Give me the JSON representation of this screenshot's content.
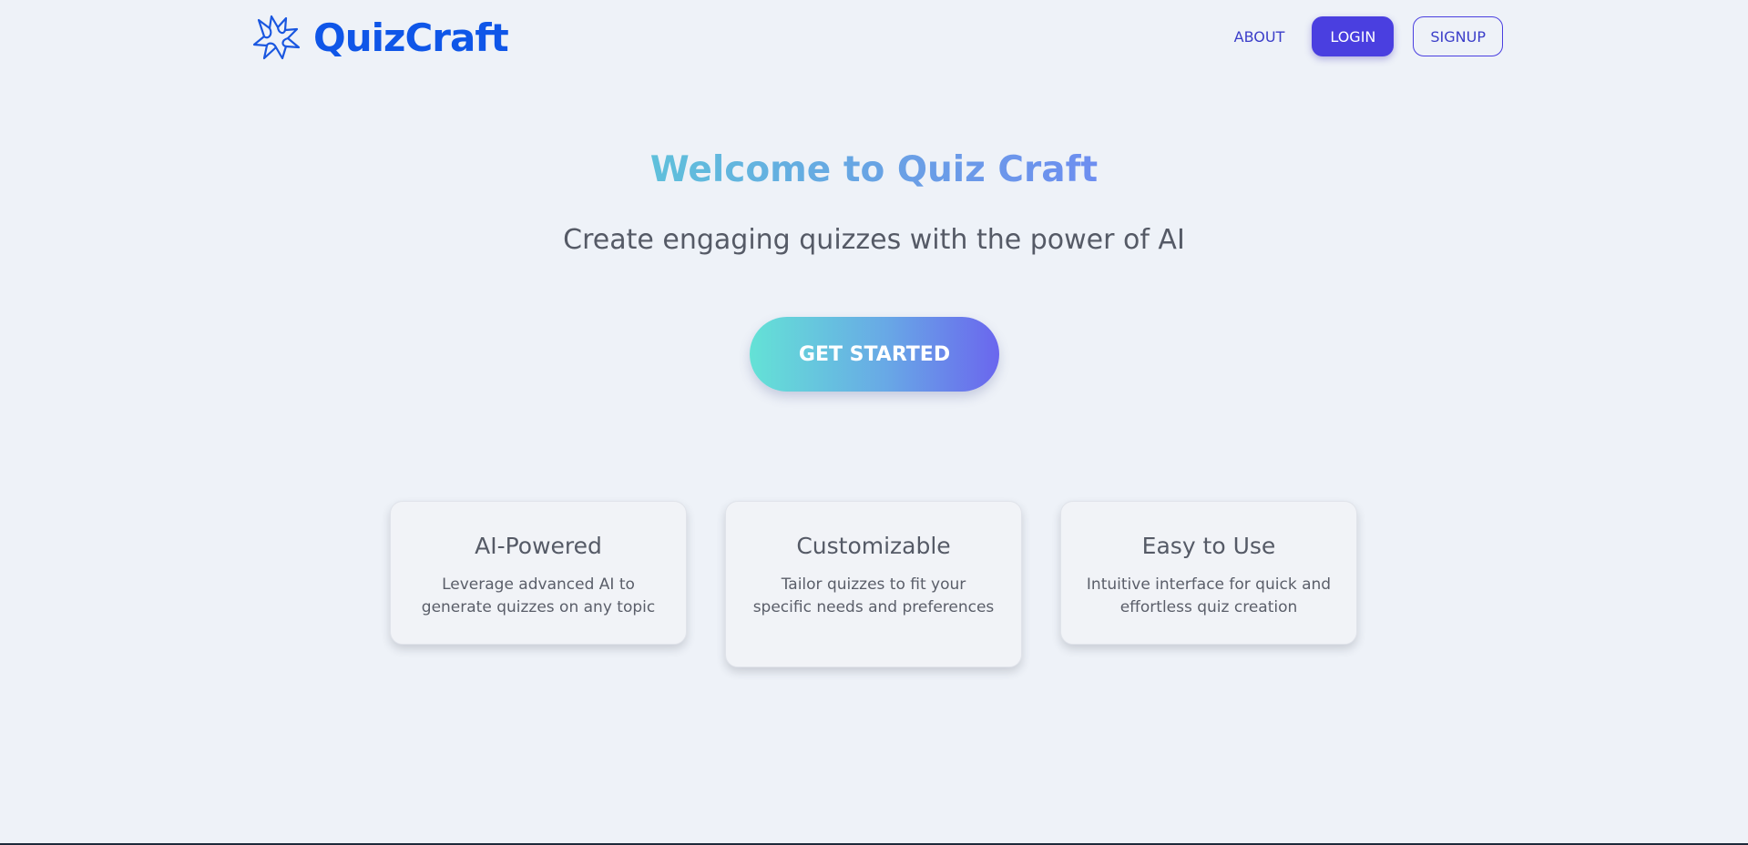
{
  "header": {
    "logo_text": "QuizCraft",
    "logo_icon": "sparkle-burst-icon",
    "nav": {
      "about_label": "ABOUT",
      "login_label": "LOGIN",
      "signup_label": "SIGNUP"
    }
  },
  "hero": {
    "title": "Welcome to Quiz Craft",
    "subtitle": "Create engaging quizzes with the power of AI",
    "cta_label": "GET STARTED"
  },
  "features": [
    {
      "title": "AI-Powered",
      "description": "Leverage advanced AI to generate quizzes on any topic"
    },
    {
      "title": "Customizable",
      "description": "Tailor quizzes to fit your specific needs and preferences"
    },
    {
      "title": "Easy to Use",
      "description": "Intuitive interface for quick and effortless quiz creation"
    }
  ],
  "colors": {
    "background": "#eef2f8",
    "brand": "#0f56e8",
    "accent": "#4a3fe0",
    "text_muted": "#555a66"
  }
}
